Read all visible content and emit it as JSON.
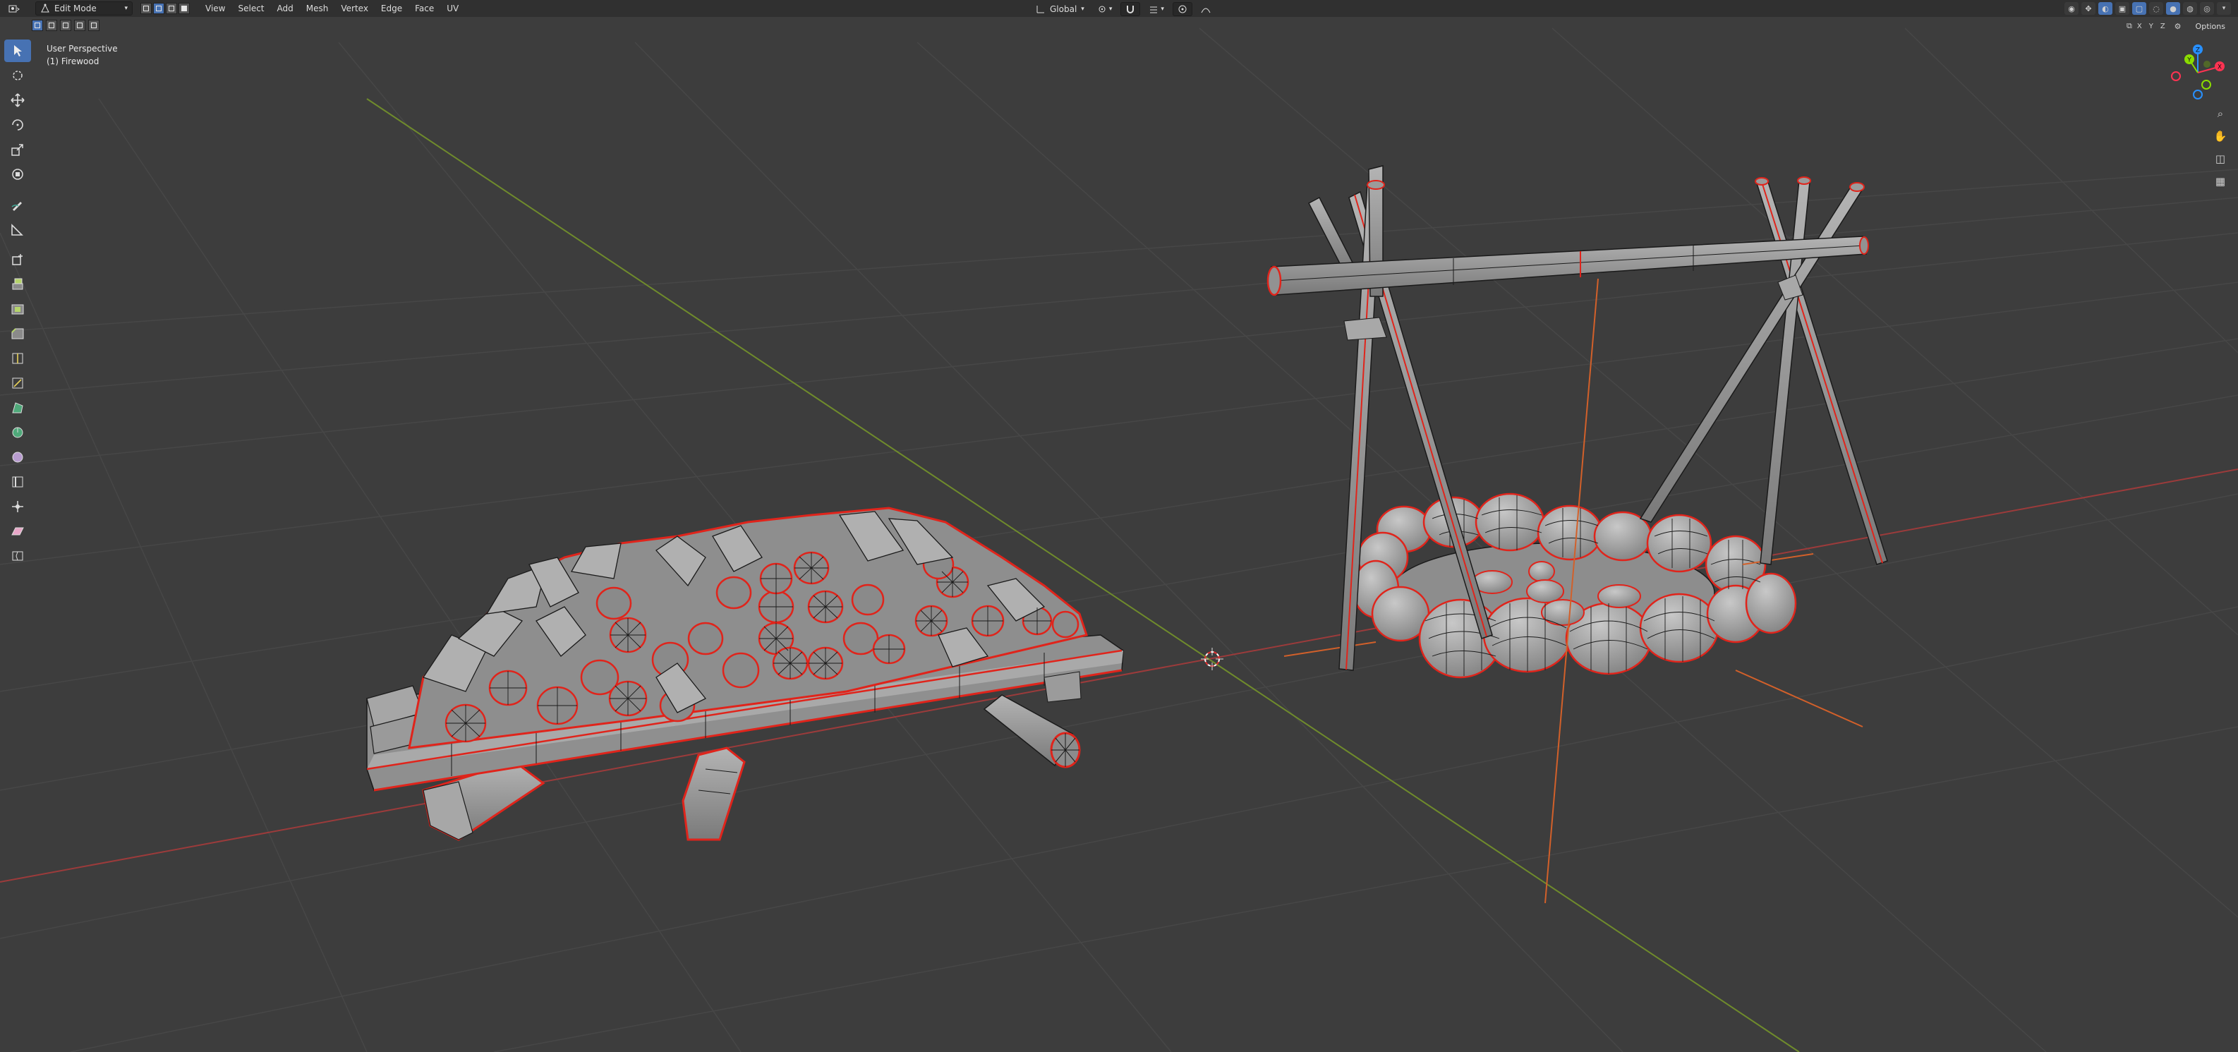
{
  "header": {
    "mode": "Edit Mode",
    "menus": [
      "View",
      "Select",
      "Add",
      "Mesh",
      "Vertex",
      "Edge",
      "Face",
      "UV"
    ],
    "transform_orientation": "Global",
    "axes": [
      "X",
      "Y",
      "Z"
    ],
    "options_label": "Options"
  },
  "viewport": {
    "view_name": "User Perspective",
    "object_name": "(1) Firewood"
  },
  "gizmo": {
    "labels": [
      "X",
      "Y",
      "Z"
    ],
    "colors": {
      "x": "#ff3352",
      "y": "#8bdc00",
      "z": "#2890ff"
    }
  },
  "toolbar": {
    "tools": [
      "tweak-select",
      "cursor",
      "move",
      "rotate",
      "scale",
      "transform",
      "annotate",
      "measure",
      "add-cube",
      "extrude",
      "inset",
      "bevel",
      "loop-cut",
      "knife",
      "poly-build",
      "spin",
      "smooth",
      "edge-slide",
      "shrink-fatten",
      "shear",
      "rip"
    ]
  },
  "colors": {
    "background": "#3d3d3d",
    "grid": "#4a4a4a",
    "x_axis": "#a03a3a",
    "y_axis": "#6e8a2a",
    "mesh_face": "#9a9a9a",
    "mesh_wire": "#1a1a1a",
    "seam": "#e0241b",
    "accent": "#4772b3"
  }
}
